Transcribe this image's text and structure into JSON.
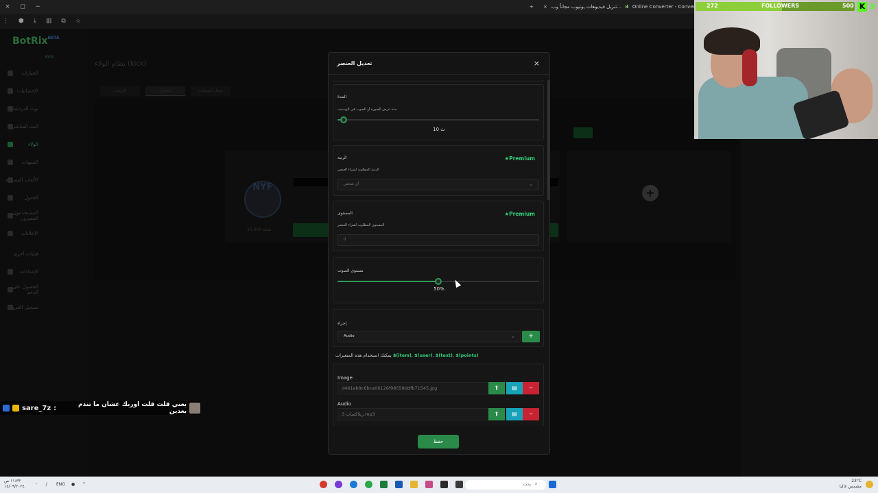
{
  "browser": {
    "tabs": [
      "تنزيل فيديوهات يوتيوب مجاناً وب...",
      "Online Converter - Convert Im..."
    ],
    "new_tab": "+",
    "close": "×"
  },
  "app": {
    "logo": "BotRix",
    "logo_beta": "BETA",
    "subtitle": "Kick",
    "page_title": "نظام الولاء (kick)",
    "tabs": [
      "الترتيب",
      "المتجر",
      "سجل المبيعات"
    ],
    "nav": [
      "الخيارات",
      "الإحصائيات",
      "بوت الدردشة",
      "البث المباشر",
      "الولاء",
      "التنبيهات",
      "الألعاب المصغرة",
      "الجدول",
      "المستخدمون المميزون",
      "الإعلانات",
      "قبليات أخرى",
      "الإعدادات",
      "الحصول على الدعم",
      "تسجيل الخروج"
    ],
    "card_logo": "NYF",
    "card_price": "10,000 نقطة"
  },
  "modal": {
    "title": "تعديل العنصر",
    "close": "×",
    "duration": {
      "label": "المدة",
      "desc": "مدة عرض الصورة أو الصوت في الويدجت",
      "value_label": "10 ث",
      "value": 0.03
    },
    "rank": {
      "label": "الرتبة",
      "desc": "الرتبة المطلوبة لشراء العنصر",
      "premium": "Premium",
      "selected": "أي شخص"
    },
    "level": {
      "label": "المستوى",
      "desc": "المستوى المطلوب لشراء العنصر",
      "premium": "Premium",
      "value": "0"
    },
    "volume": {
      "label": "مستوى الصوت",
      "value_label": "50%",
      "value": 0.5
    },
    "action": {
      "label": "إجراء",
      "selected": "Audio",
      "add": "+"
    },
    "variables_text": "يمكنك استخدام هذه المتغيرات",
    "variables": [
      "$(item)",
      "$(user)",
      "$(text)",
      "$(points)"
    ],
    "image": {
      "label": "Image",
      "filename": "d461eb9c6bca06126f98558ddfb71545.jpg"
    },
    "audio": {
      "label": "Audio",
      "filename": "ريلاكسات 3.mp3"
    },
    "upload_icon": "⬆",
    "gallery_icon": "▤",
    "remove_icon": "−",
    "save": "حفظ"
  },
  "chat": {
    "user": "sare_7z",
    "separator": ":",
    "message": "يعني قلت قلت اوريك عشان ما تندم بعدين"
  },
  "overlay": {
    "followers_label": "FOLLOWERS",
    "followers_current": "272",
    "followers_goal": "500",
    "followers_progress": 0.544,
    "kick_count": "3"
  },
  "taskbar": {
    "search_placeholder": "بحث",
    "lang": "ENG",
    "time": "١١:٣٣ ص",
    "date": "١٤/٠٩/٢٠٢٤",
    "weather_temp": "23°C",
    "weather_desc": "مشمس غالبا"
  },
  "colors": {
    "accent": "#2a8a4a",
    "premium": "#35d07a",
    "danger": "#c82333",
    "info": "#17a2b8",
    "kick": "#53fc18"
  }
}
